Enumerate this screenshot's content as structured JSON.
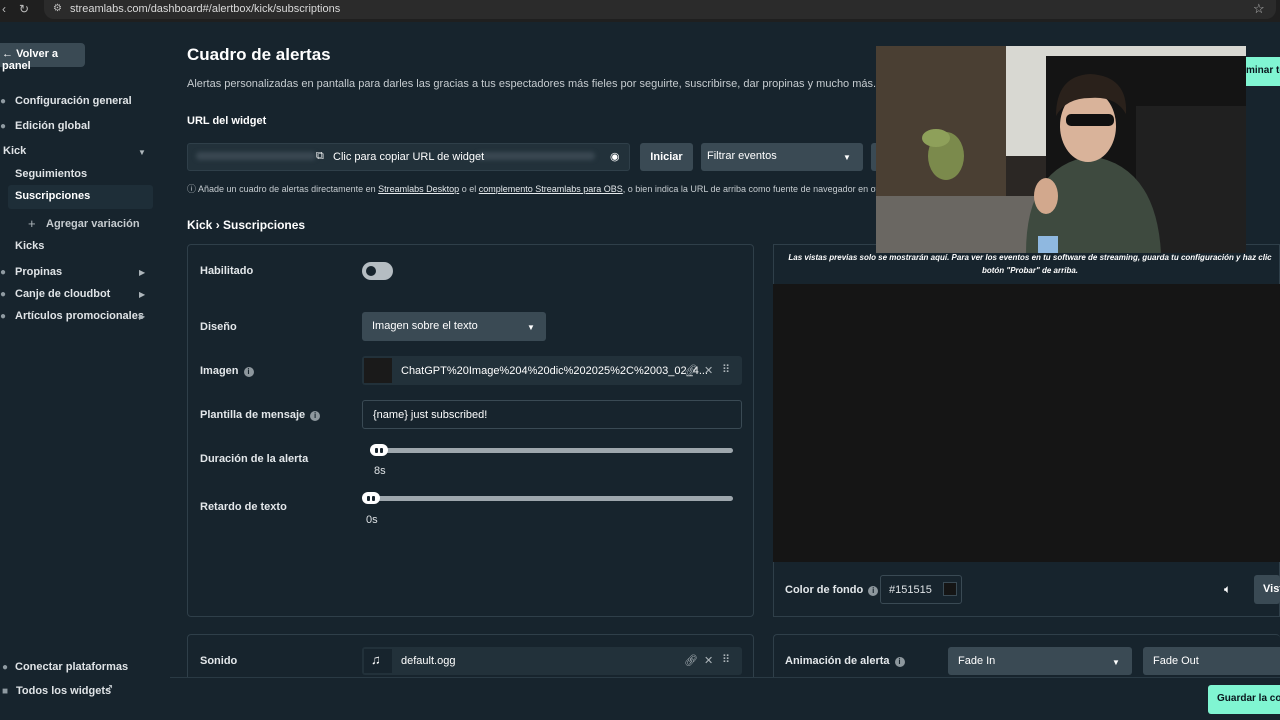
{
  "browser": {
    "url": "streamlabs.com/dashboard#/alertbox/kick/subscriptions"
  },
  "sidebar": {
    "back": "Volver a panel",
    "items": [
      {
        "label": "Configuración general"
      },
      {
        "label": "Edición global"
      },
      {
        "label": "Kick"
      },
      {
        "label": "Seguimientos"
      },
      {
        "label": "Suscripciones"
      },
      {
        "label": "Agregar variación"
      },
      {
        "label": "Kicks"
      },
      {
        "label": "Propinas"
      },
      {
        "label": "Canje de cloudbot"
      },
      {
        "label": "Artículos promocionales"
      }
    ],
    "connect": "Conectar plataformas",
    "all_widgets": "Todos los widgets"
  },
  "header": {
    "title": "Cuadro de alertas",
    "subtitle": "Alertas personalizadas en pantalla para darles las gracias a tus espectadores más fieles por seguirte, suscribirse, dar propinas y mucho más.",
    "widget_url_label": "URL del widget",
    "copy_url": "Clic para copiar URL de widget",
    "start": "Iniciar",
    "filter": "Filtrar eventos",
    "right_btn": "minar te",
    "hint_pre": "Añade un cuadro de alertas directamente en ",
    "hint_link1": "Streamlabs Desktop",
    "hint_mid": " o el ",
    "hint_link2": "complemento Streamlabs para OBS",
    "hint_post": ", o bien indica la URL de arriba como fuente de navegador en otro s"
  },
  "breadcrumb": {
    "platform": "Kick",
    "sep": "›",
    "page": "Suscripciones"
  },
  "form": {
    "enabled": "Habilitado",
    "enabled_value": false,
    "design": "Diseño",
    "design_value": "Imagen sobre el texto",
    "image": "Imagen",
    "image_value": "ChatGPT%20Image%204%20dic%202025%2C%2003_02_4...",
    "template": "Plantilla de mensaje",
    "template_value": "{name} just subscribed!",
    "duration": "Duración de la alerta",
    "duration_value": "8s",
    "delay": "Retardo de texto",
    "delay_value": "0s",
    "sound": "Sonido",
    "sound_value": "default.ogg"
  },
  "preview": {
    "note": "Las vistas previas solo se mostrarán aquí. Para ver los eventos en tu software de streaming, guarda tu configuración y haz clic botón \"Probar\" de arriba.",
    "bg_label": "Color de fondo",
    "bg_value": "#151515",
    "bg_color": "#151515",
    "view_btn": "Vist"
  },
  "animation": {
    "label": "Animación de alerta",
    "in": "Fade In",
    "out": "Fade Out"
  },
  "save": "Guardar la co"
}
